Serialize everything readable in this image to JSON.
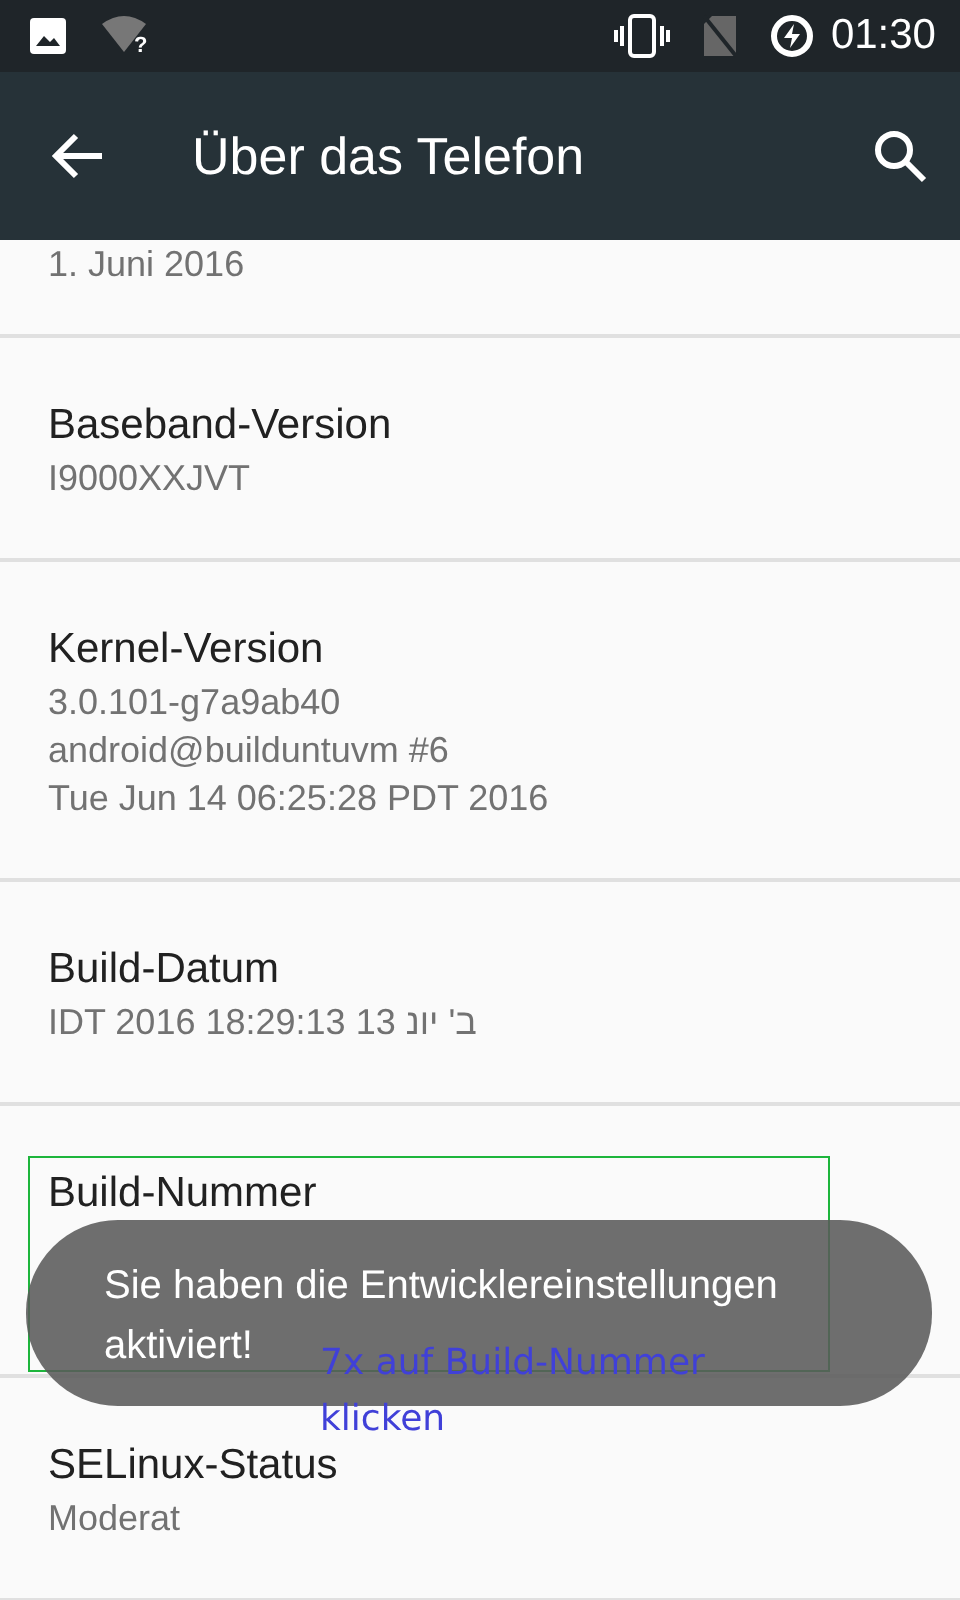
{
  "status_bar": {
    "wifi_badge": "?",
    "time": "01:30"
  },
  "toolbar": {
    "title": "Über das Telefon"
  },
  "items": [
    {
      "lines": [
        "1. Juni 2016"
      ]
    },
    {
      "title": "Baseband-Version",
      "lines": [
        "I9000XXJVT"
      ]
    },
    {
      "title": "Kernel-Version",
      "lines": [
        "3.0.101-g7a9ab40",
        "android@builduntuvm #6",
        "Tue Jun 14 06:25:28 PDT 2016"
      ]
    },
    {
      "title": "Build-Datum",
      "lines": [
        "ב' יונ 13 18:29:13 IDT 2016"
      ]
    },
    {
      "title": "Build-Nummer"
    },
    {
      "title": "SELinux-Status",
      "lines": [
        "Moderat"
      ]
    }
  ],
  "toast": {
    "text": "Sie haben die Entwicklereinstellungen aktiviert!"
  },
  "annotation": {
    "text": "7x auf Build-Nummer klicken"
  }
}
